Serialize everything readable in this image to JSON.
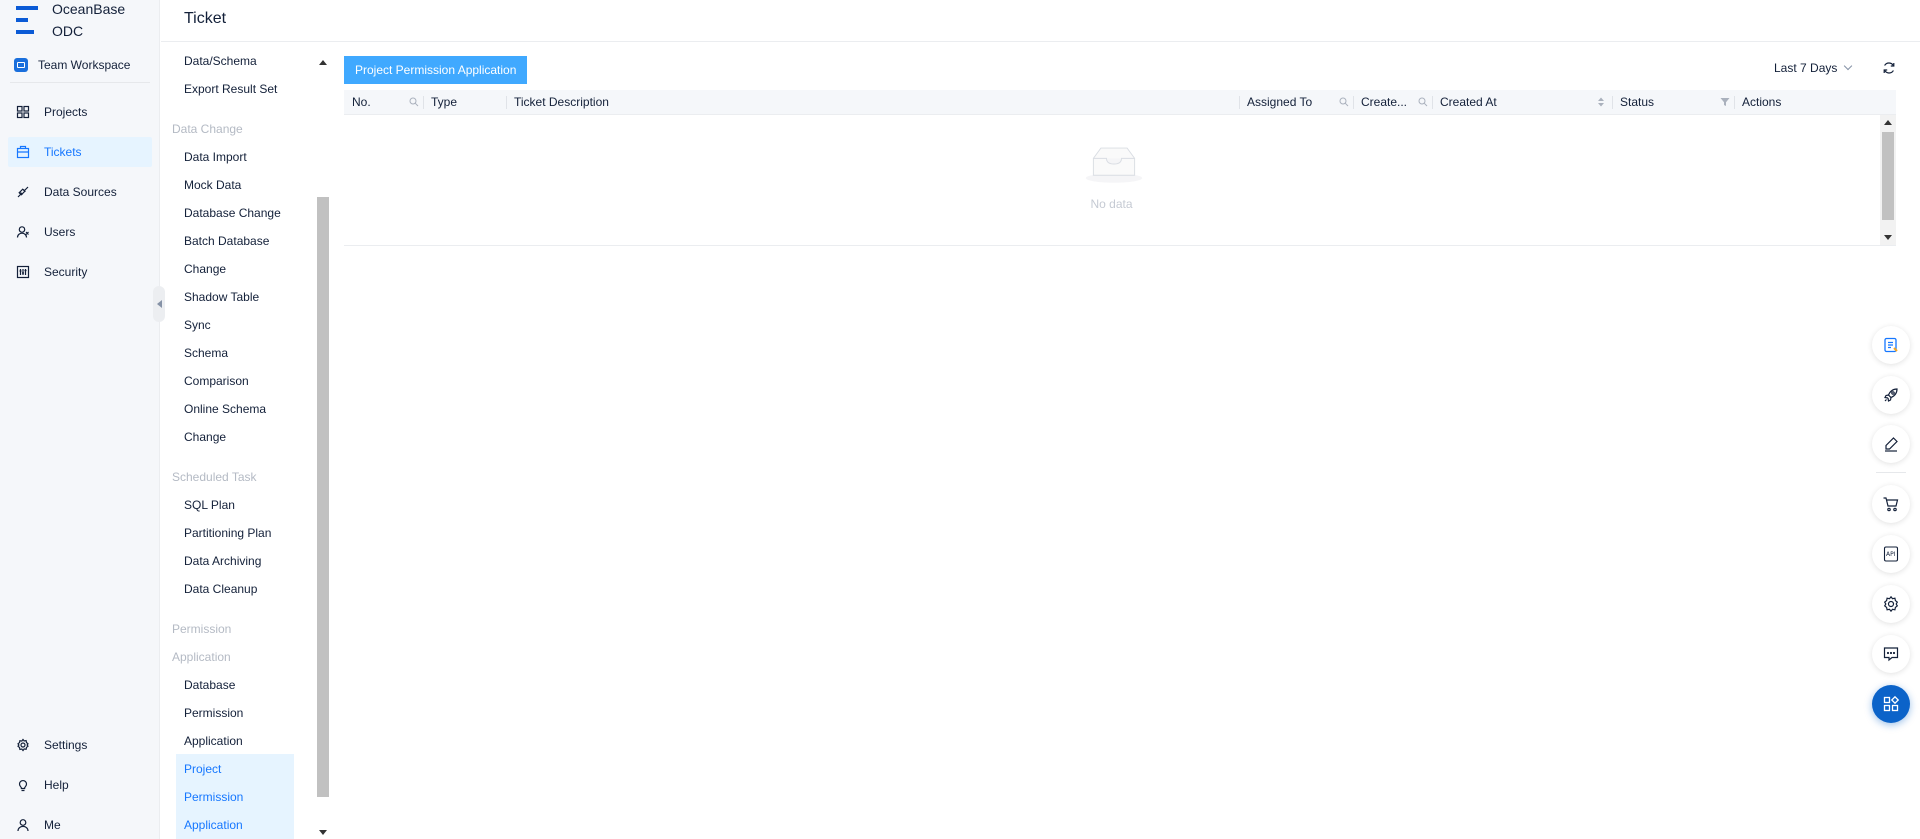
{
  "app": {
    "logo_line1": "OceanBase",
    "logo_line2": "ODC",
    "workspace": "Team Workspace"
  },
  "nav": {
    "items": [
      {
        "label": "Projects",
        "icon": "projects-icon"
      },
      {
        "label": "Tickets",
        "icon": "tickets-icon",
        "active": true
      },
      {
        "label": "Data Sources",
        "icon": "data-sources-icon"
      },
      {
        "label": "Users",
        "icon": "users-icon"
      },
      {
        "label": "Security",
        "icon": "security-icon"
      }
    ],
    "bottom": [
      {
        "label": "Settings",
        "icon": "gear-icon"
      },
      {
        "label": "Help",
        "icon": "lightbulb-icon"
      },
      {
        "label": "Me",
        "icon": "user-icon"
      }
    ]
  },
  "page": {
    "title": "Ticket"
  },
  "submenu": {
    "export_items": [
      "Data/Schema",
      "Export Result Set"
    ],
    "data_change_group": "Data Change",
    "data_change_items": [
      "Data Import",
      "Mock Data",
      "Database Change",
      "Batch Database",
      "Change",
      "Shadow Table",
      "Sync",
      "Schema",
      "Comparison",
      "Online Schema",
      "Change"
    ],
    "scheduled_group": "Scheduled Task",
    "scheduled_items": [
      "SQL Plan",
      "Partitioning Plan",
      "Data Archiving",
      "Data Cleanup"
    ],
    "permission_group_line1": "Permission",
    "permission_group_line2": "Application",
    "permission_items": [
      "Database",
      "Permission",
      "Application"
    ],
    "selected_lines": [
      "Project",
      "Permission",
      "Application"
    ]
  },
  "main": {
    "primary_button": "Project Permission Application",
    "date_range": "Last 7 Days",
    "columns": [
      "No.",
      "Type",
      "Ticket Description",
      "Assigned To",
      "Create...",
      "Created At",
      "Status",
      "Actions"
    ],
    "empty_text": "No data"
  },
  "colors": {
    "accent": "#1677ff",
    "button": "#40a9ff",
    "active_bg": "#e6f4ff",
    "fab": "#0b63c9"
  },
  "floating_tools": [
    "task-icon",
    "rocket-icon",
    "edit-icon",
    "cart-icon",
    "api-icon",
    "gear-icon",
    "feedback-icon",
    "apps-icon"
  ]
}
